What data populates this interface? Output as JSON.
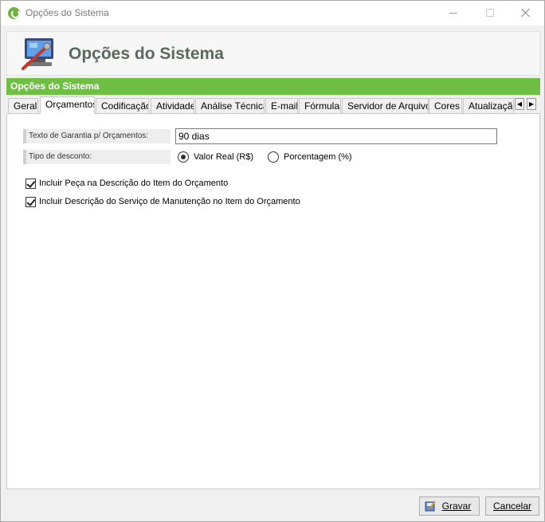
{
  "window": {
    "title": "Opções do Sistema",
    "accent": "#6fbf44"
  },
  "header": {
    "title": "Opções do Sistema",
    "icon": "computer-settings-icon"
  },
  "group": {
    "title": "Opções do Sistema"
  },
  "tabs": [
    {
      "label": "Geral"
    },
    {
      "label": "Orçamentos"
    },
    {
      "label": "Codificação"
    },
    {
      "label": "Atividade"
    },
    {
      "label": "Análise Técnica"
    },
    {
      "label": "E-mail"
    },
    {
      "label": "Fórmulas"
    },
    {
      "label": "Servidor de Arquivos"
    },
    {
      "label": "Cores"
    },
    {
      "label": "Atualização"
    }
  ],
  "active_tab": "Orçamentos",
  "form": {
    "warranty_label": "Texto de Garantia p/ Orçamentos:",
    "warranty_value": "90 dias",
    "discount_label": "Tipo de desconto:",
    "discount_options": [
      {
        "label": "Valor Real (R$)",
        "selected": true
      },
      {
        "label": "Porcentagem (%)",
        "selected": false
      }
    ],
    "checkboxes": [
      {
        "label": "Incluir Peça na Descrição do Item do Orçamento",
        "checked": true
      },
      {
        "label": "Incluir Descrição do Serviço de Manutenção no Item do Orçamento",
        "checked": true
      }
    ]
  },
  "footer": {
    "save_label": "Gravar",
    "cancel_label": "Cancelar"
  }
}
